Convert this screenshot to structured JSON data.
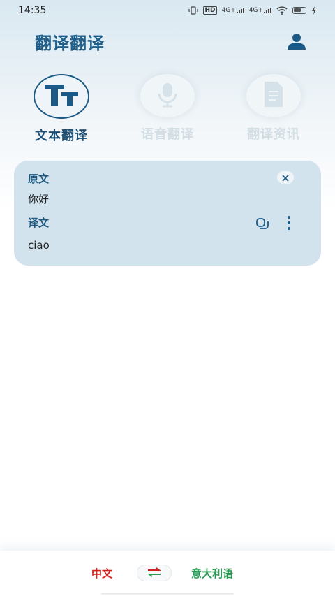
{
  "status_bar": {
    "time": "14:35",
    "hd_label": "HD",
    "net1": "4G+",
    "net2": "4G+",
    "icons": [
      "vibrate-icon",
      "hd-icon",
      "signal-icon",
      "signal-icon",
      "wifi-icon",
      "battery-icon",
      "charging-icon"
    ]
  },
  "header": {
    "title": "翻译翻译",
    "user_icon": "user-icon"
  },
  "tabs": [
    {
      "label": "文本翻译",
      "icon": "text-translate-icon",
      "active": true
    },
    {
      "label": "语音翻译",
      "icon": "microphone-icon",
      "active": false
    },
    {
      "label": "翻译资讯",
      "icon": "document-icon",
      "active": false
    }
  ],
  "card": {
    "source_label": "原文",
    "source_text": "你好",
    "target_label": "译文",
    "target_text": "ciao",
    "icons": [
      "close-icon",
      "copy-icon",
      "more-icon"
    ]
  },
  "bottom": {
    "source_lang": "中文",
    "target_lang": "意大利语",
    "colors": {
      "source": "#d0211c",
      "target": "#2a9a55",
      "accent": "#1c5a86"
    }
  }
}
